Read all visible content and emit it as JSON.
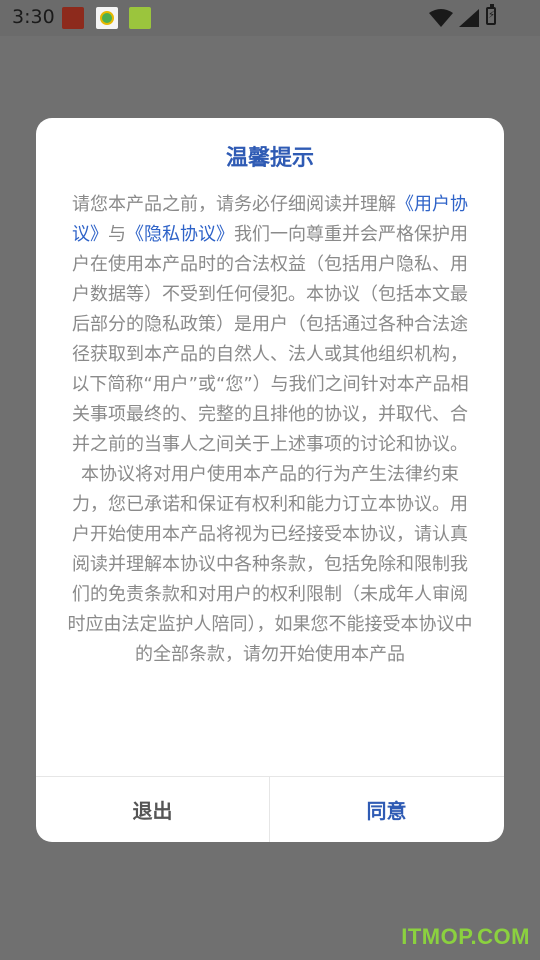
{
  "status_bar": {
    "time": "3:30",
    "icons": [
      "app-icon-seal",
      "app-icon-yk",
      "app-icon-green",
      "wifi-icon",
      "signal-icon",
      "battery-icon"
    ]
  },
  "dialog": {
    "title": "温馨提示",
    "body": {
      "prefix": "请您本产品之前，请务必仔细阅读并理解",
      "link_user": "《用户协议》",
      "and": "与",
      "link_privacy": "《隐私协议》",
      "suffix": "我们一向尊重并会严格保护用户在使用本产品时的合法权益（包括用户隐私、用户数据等）不受到任何侵犯。本协议（包括本文最后部分的隐私政策）是用户（包括通过各种合法途径获取到本产品的自然人、法人或其他组织机构，以下简称“用户”或“您”）与我们之间针对本产品相关事项最终的、完整的且排他的协议，并取代、合并之前的当事人之间关于上述事项的讨论和协议。本协议将对用户使用本产品的行为产生法律约束力，您已承诺和保证有权利和能力订立本协议。用户开始使用本产品将视为已经接受本协议，请认真阅读并理解本协议中各种条款，包括免除和限制我们的免责条款和对用户的权利限制（未成年人审阅时应由法定监护人陪同），如果您不能接受本协议中的全部条款，请勿开始使用本产品"
    },
    "buttons": {
      "exit": "退出",
      "agree": "同意"
    }
  },
  "watermark": "ITMOP.COM",
  "colors": {
    "overlay": "#707070",
    "title": "#2f5bb4",
    "link": "#2f63c8",
    "body_text": "#8a8a8a",
    "watermark": "#8bd13f"
  }
}
